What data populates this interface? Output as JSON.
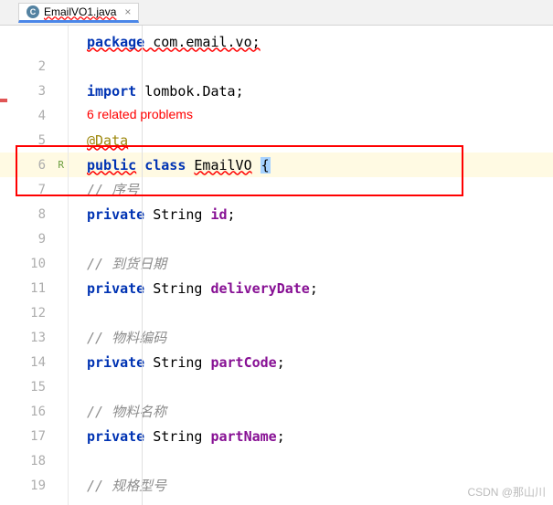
{
  "tab": {
    "icon_letter": "C",
    "filename": "EmailVO1.java",
    "close": "×"
  },
  "gutter": {
    "lines": [
      "",
      "2",
      "3",
      "4",
      "5",
      "6",
      "7",
      "8",
      "9",
      "10",
      "11",
      "12",
      "13",
      "14",
      "15",
      "16",
      "17",
      "18",
      "19"
    ]
  },
  "hint": "6 related problems",
  "code": {
    "l1_pkg": "package",
    "l1_rest": " com.email.vo;",
    "l3_import": "import",
    "l3_rest": " lombok.",
    "l3_data": "Data",
    "l3_semi": ";",
    "l5_anno": "@Data",
    "l6_public": "public",
    "l6_class": " class ",
    "l6_name": "EmailVO",
    "l6_brace": "{",
    "l7_c": "// 序号",
    "l8_priv": "private",
    "l8_type": " String ",
    "l8_name": "id",
    "l8_semi": ";",
    "l10_c": "// 到货日期",
    "l11_priv": "private",
    "l11_type": " String ",
    "l11_name": "deliveryDate",
    "l11_semi": ";",
    "l13_c": "// 物料编码",
    "l14_priv": "private",
    "l14_type": " String ",
    "l14_name": "partCode",
    "l14_semi": ";",
    "l16_c": "// 物料名称",
    "l17_priv": "private",
    "l17_type": " String ",
    "l17_name": "partName",
    "l17_semi": ";",
    "l19_c": "// 规格型号"
  },
  "watermark": "CSDN @那山川"
}
